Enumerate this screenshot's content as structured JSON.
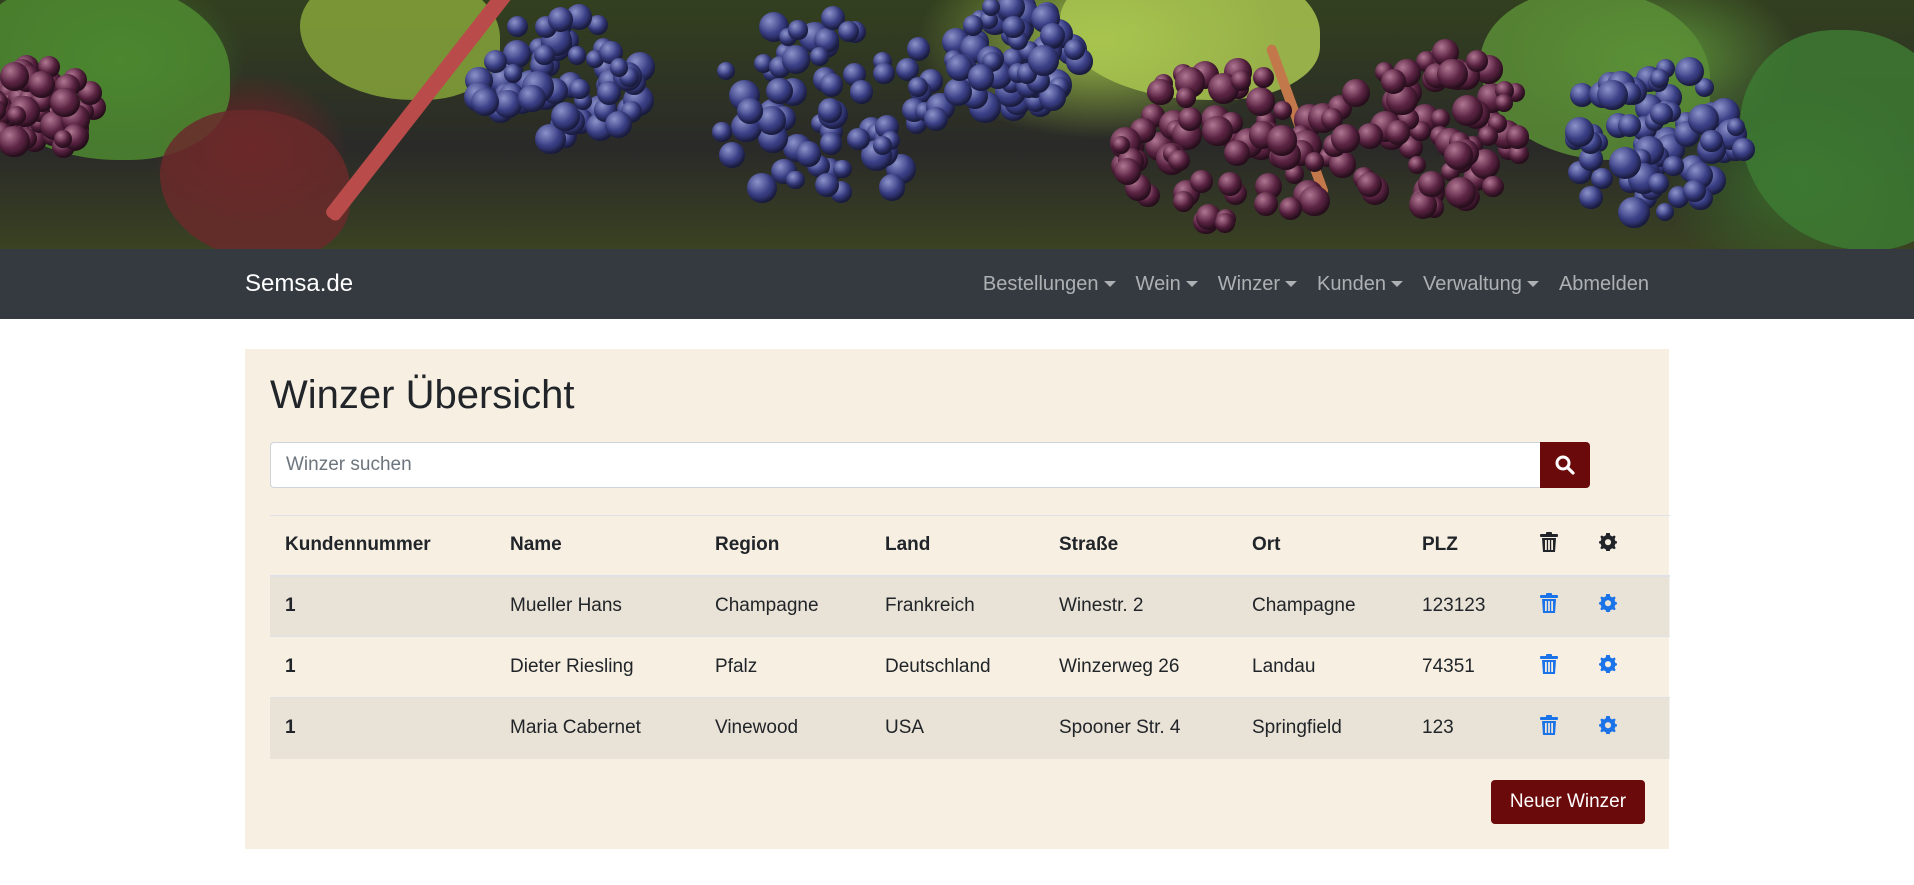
{
  "banner": {
    "image": "vineyard-grapes-banner"
  },
  "navbar": {
    "brand": "Semsa.de",
    "items": [
      {
        "label": "Bestellungen",
        "dropdown": true
      },
      {
        "label": "Wein",
        "dropdown": true
      },
      {
        "label": "Winzer",
        "dropdown": true
      },
      {
        "label": "Kunden",
        "dropdown": true
      },
      {
        "label": "Verwaltung",
        "dropdown": true
      },
      {
        "label": "Abmelden",
        "dropdown": false
      }
    ]
  },
  "main": {
    "title": "Winzer Übersicht",
    "search": {
      "placeholder": "Winzer suchen",
      "value": "",
      "icon": "search-icon"
    },
    "table": {
      "headers": [
        "Kundennummer",
        "Name",
        "Region",
        "Land",
        "Straße",
        "Ort",
        "PLZ"
      ],
      "header_icons": [
        "trash-icon",
        "gear-icon"
      ],
      "rows": [
        [
          "1",
          "Mueller Hans",
          "Champagne",
          "Frankreich",
          "Winestr. 2",
          "Champagne",
          "123123"
        ],
        [
          "1",
          "Dieter Riesling",
          "Pfalz",
          "Deutschland",
          "Winzerweg 26",
          "Landau",
          "74351"
        ],
        [
          "1",
          "Maria Cabernet",
          "Vinewood",
          "USA",
          "Spooner Str. 4",
          "Springfield",
          "123"
        ]
      ]
    },
    "new_button": "Neuer Winzer"
  },
  "colors": {
    "accent": "#6b0a0a",
    "navbar": "#343a40",
    "card": "#f6efe2",
    "action_icon": "#1a73e8"
  }
}
